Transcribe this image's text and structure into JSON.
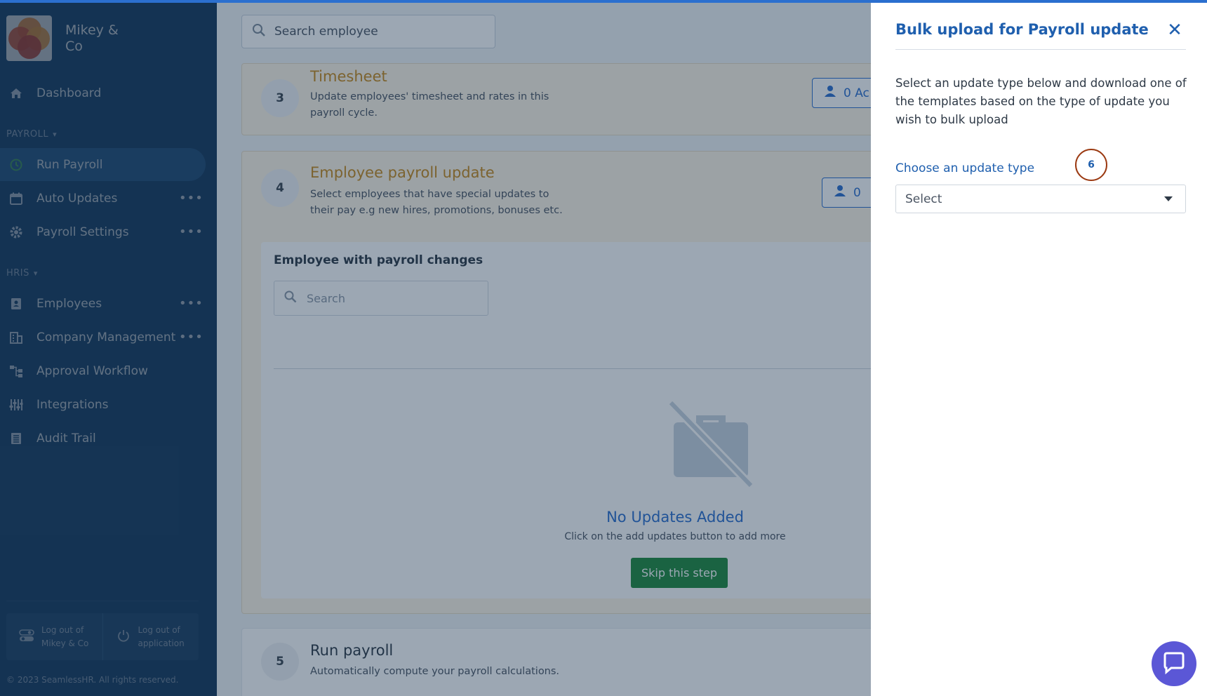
{
  "brand": {
    "name": "Mikey & Co"
  },
  "sidebar": {
    "dashboard": "Dashboard",
    "payroll_section": "PAYROLL",
    "payroll_items": [
      {
        "label": "Run Payroll",
        "active": true
      },
      {
        "label": "Auto Updates",
        "more": true
      },
      {
        "label": "Payroll Settings",
        "more": true
      }
    ],
    "hris_section": "HRIS",
    "hris_items": [
      {
        "label": "Employees",
        "more": true
      },
      {
        "label": "Company Management",
        "more": true
      },
      {
        "label": "Approval Workflow"
      },
      {
        "label": "Integrations"
      },
      {
        "label": "Audit Trail"
      }
    ],
    "logout_company": "Log out of Mikey & Co",
    "logout_app": "Log out of application",
    "copyright": "© 2023 SeamlessHR. All rights reserved."
  },
  "main": {
    "search_placeholder": "Search employee",
    "steps": [
      {
        "number": "3",
        "title": "Timesheet",
        "desc": "Update employees' timesheet and rates in this payroll cycle.",
        "button": "0 Ac"
      },
      {
        "number": "4",
        "title": "Employee payroll update",
        "desc": "Select employees that have special updates to their pay e.g new hires, promotions, bonuses etc.",
        "button": "0"
      },
      {
        "number": "5",
        "title": "Run payroll",
        "desc": "Automatically compute your payroll calculations."
      }
    ],
    "changes": {
      "title": "Employee with payroll changes",
      "search_placeholder": "Search",
      "empty_title": "No Updates Added",
      "empty_sub": "Click on the add updates button to add more",
      "skip_button": "Skip this step"
    }
  },
  "drawer": {
    "title": "Bulk upload for Payroll update",
    "description": "Select an update type below and download one of the templates based on the type of update you wish to bulk upload",
    "label": "Choose an update type",
    "step_badge": "6",
    "select_value": "Select"
  },
  "colors": {
    "sidebar": "#1f4e7a",
    "accent": "#1f5fae",
    "skip_button": "#1f8a3d",
    "badge_ring": "#9b3a12",
    "chat": "#5b57d6"
  }
}
